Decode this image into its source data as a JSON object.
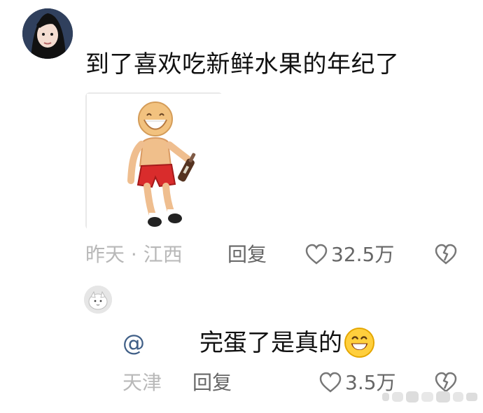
{
  "post": {
    "avatar_icon": "user-avatar-icon",
    "comment_text": "到了喜欢吃新鲜水果的年纪了",
    "sticker_icon": "cartoon-man-with-bottle-sticker",
    "time": "昨天 · 江西",
    "reply_label": "回复",
    "like_icon": "heart-icon",
    "like_count": "32.5万",
    "dislike_icon": "broken-heart-icon"
  },
  "reply": {
    "avatar_icon": "white-cat-avatar-icon",
    "mention": "@",
    "comment_text": "完蛋了是真的",
    "emoji_icon": "grinning-face-emoji",
    "location": "天津",
    "reply_label": "回复",
    "like_icon": "heart-icon",
    "like_count": "3.5万",
    "dislike_icon": "broken-heart-icon"
  },
  "watermark_icon": "blurred-watermark-icon"
}
